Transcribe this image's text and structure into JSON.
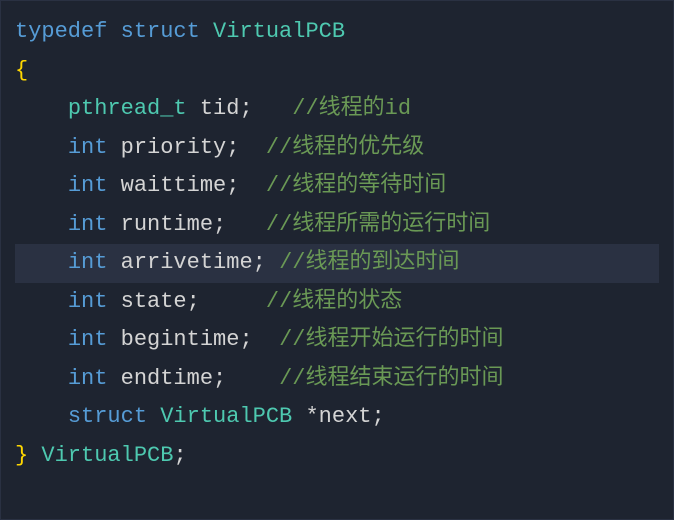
{
  "code": {
    "line1": {
      "kw1": "typedef",
      "kw2": "struct",
      "type": "VirtualPCB"
    },
    "line2": {
      "brace": "{"
    },
    "line3": {
      "indent": "    ",
      "type": "pthread_t",
      "id": "tid",
      "semi": ";",
      "spacer": "   ",
      "comment": "//线程的id"
    },
    "line4": {
      "indent": "    ",
      "type": "int",
      "id": "priority",
      "semi": ";",
      "spacer": "  ",
      "comment": "//线程的优先级"
    },
    "line5": {
      "indent": "    ",
      "type": "int",
      "id": "waittime",
      "semi": ";",
      "spacer": "  ",
      "comment": "//线程的等待时间"
    },
    "line6": {
      "indent": "    ",
      "type": "int",
      "id": "runtime",
      "semi": ";",
      "spacer": "   ",
      "comment": "//线程所需的运行时间"
    },
    "line7": {
      "indent": "    ",
      "type": "int",
      "id": "arrivetime",
      "semi": ";",
      "spacer": " ",
      "comment": "//线程的到达时间"
    },
    "line8": {
      "indent": "    ",
      "type": "int",
      "id": "state",
      "semi": ";",
      "spacer": "     ",
      "comment": "//线程的状态"
    },
    "line9": {
      "indent": "    ",
      "type": "int",
      "id": "begintime",
      "semi": ";",
      "spacer": "  ",
      "comment": "//线程开始运行的时间"
    },
    "line10": {
      "indent": "    ",
      "type": "int",
      "id": "endtime",
      "semi": ";",
      "spacer": "    ",
      "comment": "//线程结束运行的时间"
    },
    "line11": {
      "indent": "    ",
      "kw": "struct",
      "type": "VirtualPCB",
      "star": "*",
      "id": "next",
      "semi": ";"
    },
    "line12": {
      "brace": "}",
      "type": "VirtualPCB",
      "semi": ";"
    }
  }
}
